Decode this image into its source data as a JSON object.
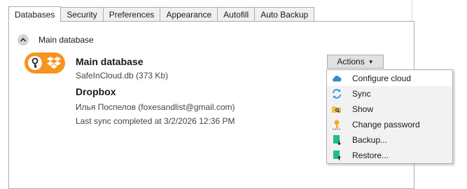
{
  "tabs": [
    {
      "label": "Databases",
      "active": true
    },
    {
      "label": "Security",
      "active": false
    },
    {
      "label": "Preferences",
      "active": false
    },
    {
      "label": "Appearance",
      "active": false
    },
    {
      "label": "Autofill",
      "active": false
    },
    {
      "label": "Auto Backup",
      "active": false
    }
  ],
  "section": {
    "title": "Main database",
    "expanded": true
  },
  "database": {
    "name": "Main database",
    "file": "SafeInCloud.db (373 Kb)",
    "provider": "Dropbox",
    "account": "Илья Поспелов (foxesandlist@gmail.com)",
    "last_sync": "Last sync completed at 3/2/2026 12:36 PM",
    "logo_color": "#f7941d"
  },
  "actions": {
    "label": "Actions",
    "menu": [
      {
        "label": "Configure cloud",
        "icon": "cloud-icon",
        "highlighted": true
      },
      {
        "label": "Sync",
        "icon": "sync-icon",
        "highlighted": false
      },
      {
        "label": "Show",
        "icon": "folder-search-icon",
        "highlighted": false
      },
      {
        "label": "Change password",
        "icon": "key-icon",
        "highlighted": false
      },
      {
        "label": "Backup...",
        "icon": "backup-icon",
        "highlighted": false
      },
      {
        "label": "Restore...",
        "icon": "restore-icon",
        "highlighted": false
      }
    ]
  }
}
